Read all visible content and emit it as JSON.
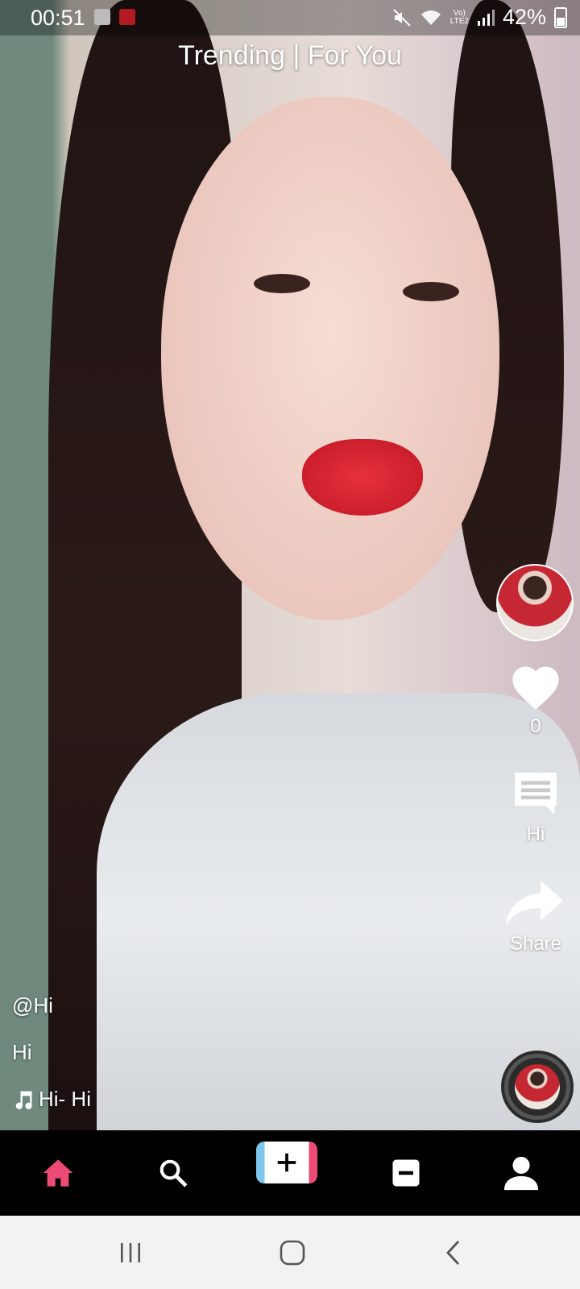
{
  "status_bar": {
    "time": "00:51",
    "network_label_top": "Vo)",
    "network_label_bottom": "LTE2",
    "battery": "42%"
  },
  "header": {
    "title": "Trending | For You"
  },
  "side_actions": {
    "like_count": "0",
    "comment_label": "Hi",
    "share_label": "Share"
  },
  "caption": {
    "username": "@Hi",
    "description": "Hi",
    "sound": "Hi- Hi"
  },
  "bottom_nav": {
    "items": [
      "home-icon",
      "search-icon",
      "plus-icon",
      "minus-icon",
      "profile-icon"
    ],
    "active_color": "#ee4a76"
  },
  "colors": {
    "accent_pink": "#ee4a76",
    "accent_blue": "#7fc7ef"
  }
}
